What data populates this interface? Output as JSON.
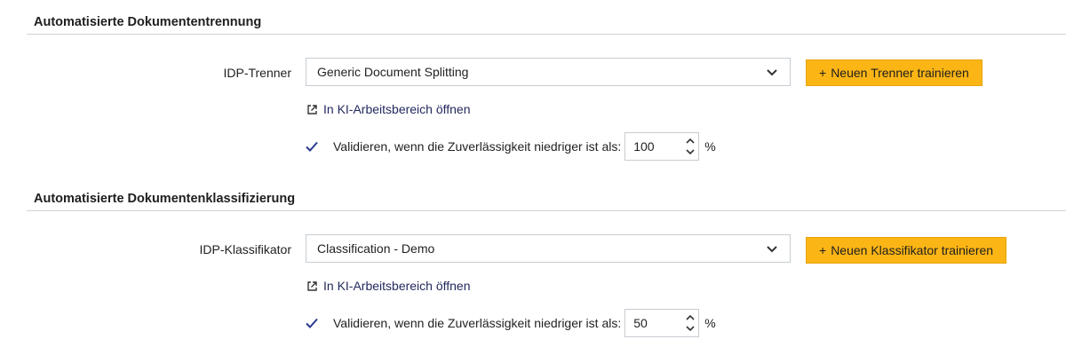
{
  "sections": [
    {
      "title": "Automatisierte Dokumententrennung",
      "field_label": "IDP-Trenner",
      "select_value": "Generic Document Splitting",
      "button_label": "Neuen Trenner trainieren",
      "link_label": "In KI-Arbeitsbereich öffnen",
      "validate_label": "Validieren, wenn die Zuverlässigkeit niedriger ist als:",
      "threshold": "100",
      "unit": "%",
      "validate_checked": true
    },
    {
      "title": "Automatisierte Dokumentenklassifizierung",
      "field_label": "IDP-Klassifikator",
      "select_value": "Classification - Demo",
      "button_label": "Neuen Klassifikator trainieren",
      "link_label": "In KI-Arbeitsbereich öffnen",
      "validate_label": "Validieren, wenn die Zuverlässigkeit niedriger ist als:",
      "threshold": "50",
      "unit": "%",
      "validate_checked": true
    }
  ],
  "colors": {
    "button_bg": "#fbb515",
    "link": "#23295f",
    "check": "#2b3a8c"
  },
  "icons": {
    "plus": "+"
  }
}
